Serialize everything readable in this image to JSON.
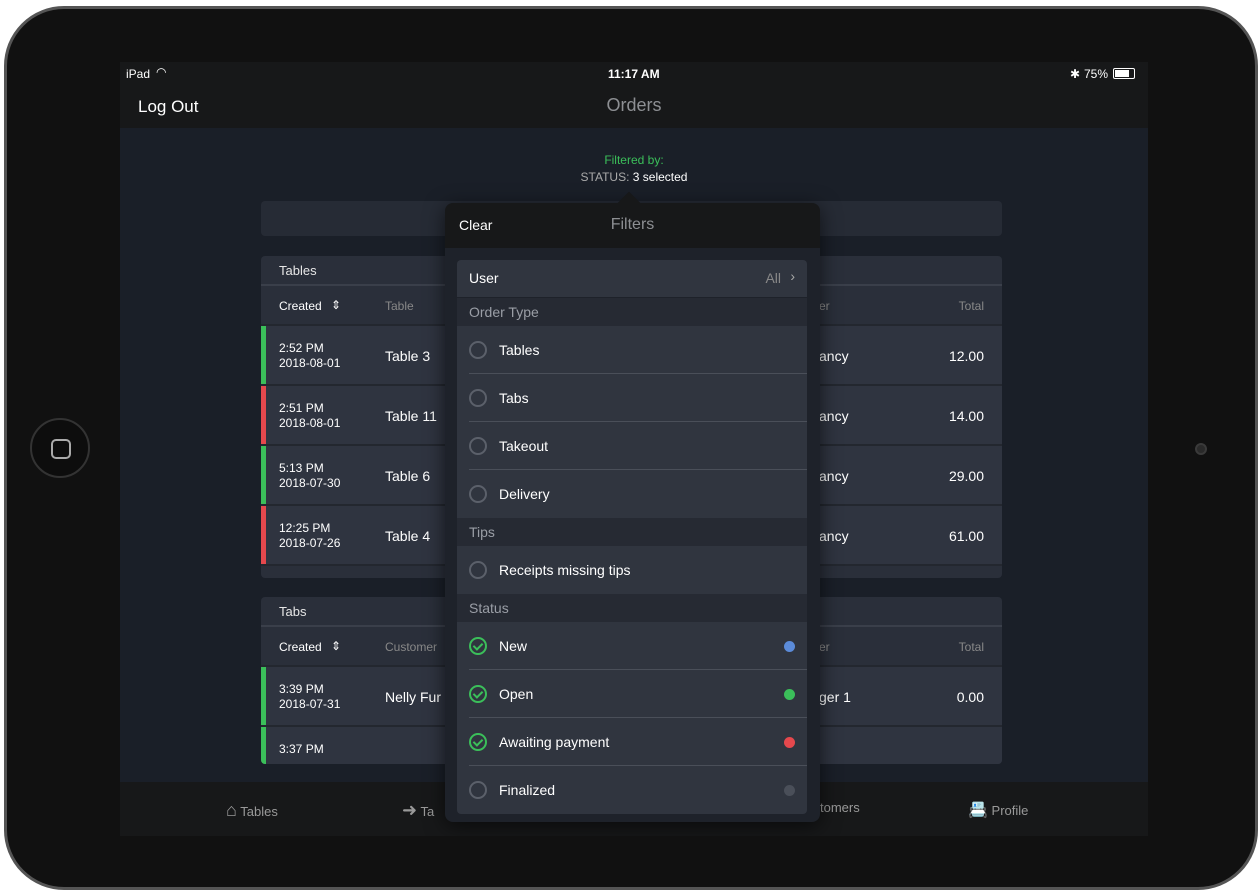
{
  "status_bar": {
    "device": "iPad",
    "time": "11:17 AM",
    "battery": "75%"
  },
  "nav": {
    "left_button": "Log Out",
    "title": "Orders"
  },
  "filter_summary": {
    "label": "Filtered by:",
    "key": "STATUS:",
    "value": "3 selected"
  },
  "tables_card": {
    "title": "Tables",
    "columns": [
      "Created",
      "Table",
      "er",
      "Total"
    ],
    "rows": [
      {
        "time": "2:52 PM",
        "date": "2018-08-01",
        "table": "Table 3",
        "user": "ancy",
        "total": "12.00",
        "status_color": "#3bbf5a"
      },
      {
        "time": "2:51 PM",
        "date": "2018-08-01",
        "table": "Table 11",
        "user": "ancy",
        "total": "14.00",
        "status_color": "#e5484d"
      },
      {
        "time": "5:13 PM",
        "date": "2018-07-30",
        "table": "Table 6",
        "user": "ancy",
        "total": "29.00",
        "status_color": "#3bbf5a"
      },
      {
        "time": "12:25 PM",
        "date": "2018-07-26",
        "table": "Table 4",
        "user": "ancy",
        "total": "61.00",
        "status_color": "#e5484d"
      }
    ]
  },
  "tabs_card": {
    "title": "Tabs",
    "columns": [
      "Created",
      "Customer",
      "er",
      "Total"
    ],
    "rows": [
      {
        "time": "3:39 PM",
        "date": "2018-07-31",
        "customer": "Nelly Fur",
        "user": "ger 1",
        "total": "0.00",
        "status_color": "#3bbf5a"
      },
      {
        "time": "3:37 PM",
        "date": "",
        "customer": "",
        "user": "",
        "total": "",
        "status_color": "#3bbf5a"
      }
    ]
  },
  "popover": {
    "clear": "Clear",
    "title": "Filters",
    "user": {
      "label": "User",
      "value": "All"
    },
    "order_type": {
      "header": "Order Type",
      "items": [
        {
          "label": "Tables",
          "checked": false
        },
        {
          "label": "Tabs",
          "checked": false
        },
        {
          "label": "Takeout",
          "checked": false
        },
        {
          "label": "Delivery",
          "checked": false
        }
      ]
    },
    "tips": {
      "header": "Tips",
      "items": [
        {
          "label": "Receipts missing tips",
          "checked": false
        }
      ]
    },
    "status": {
      "header": "Status",
      "items": [
        {
          "label": "New",
          "checked": true,
          "color": "#5b8bd9"
        },
        {
          "label": "Open",
          "checked": true,
          "color": "#3bbf5a"
        },
        {
          "label": "Awaiting payment",
          "checked": true,
          "color": "#e5484d"
        },
        {
          "label": "Finalized",
          "checked": false,
          "color": "#4a4f59"
        }
      ]
    }
  },
  "tab_bar": {
    "items": [
      "Tables",
      "Ta",
      "tomers",
      "Profile"
    ]
  },
  "colors": {
    "accent_green": "#3bbf5a"
  }
}
